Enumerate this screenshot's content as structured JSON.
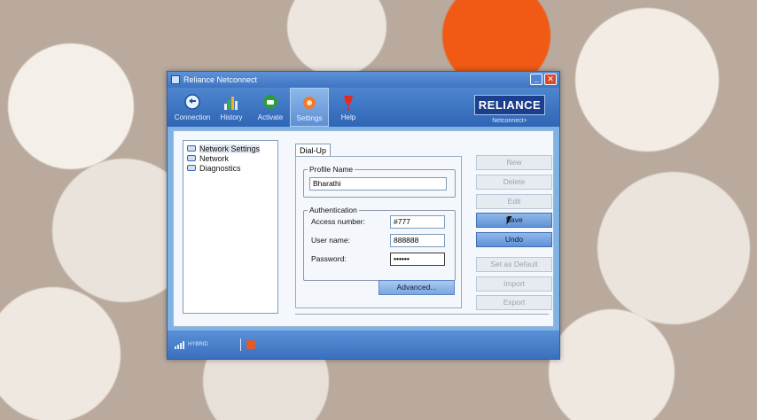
{
  "window": {
    "title": "Reliance Netconnect",
    "minimize_label": "_",
    "close_label": "✕"
  },
  "toolbar": {
    "items": [
      {
        "label": "Connection",
        "icon": "connection-icon"
      },
      {
        "label": "History",
        "icon": "history-icon"
      },
      {
        "label": "Activate",
        "icon": "activate-icon"
      },
      {
        "label": "Settings",
        "icon": "settings-icon",
        "active": true
      },
      {
        "label": "Help",
        "icon": "help-icon"
      }
    ],
    "brand": "RELIANCE",
    "brand_sub": "Netconnect+"
  },
  "tree": {
    "items": [
      {
        "label": "Network Settings",
        "selected": true
      },
      {
        "label": "Network"
      },
      {
        "label": "Diagnostics"
      }
    ]
  },
  "tab": "Dial-Up",
  "profile": {
    "group_label": "Profile Name",
    "value": "Bharathi"
  },
  "auth": {
    "group_label": "Authentication",
    "access_label": "Access number:",
    "access_value": "#777",
    "user_label": "User name:",
    "user_value": "888888",
    "password_label": "Password:",
    "password_value": "••••••"
  },
  "advanced_label": "Advanced...",
  "side_buttons": [
    {
      "label": "New",
      "enabled": false
    },
    {
      "label": "Delete",
      "enabled": false
    },
    {
      "label": "Edit",
      "enabled": false
    },
    {
      "label": "Save",
      "enabled": true
    },
    {
      "label": "Undo",
      "enabled": true
    },
    {
      "label": "Set as Default",
      "enabled": false
    },
    {
      "label": "Import",
      "enabled": false
    },
    {
      "label": "Export",
      "enabled": false
    }
  ],
  "status": {
    "network_label": "HYBRID"
  },
  "colors": {
    "accent": "#3f74c2",
    "close": "#d9482b"
  }
}
